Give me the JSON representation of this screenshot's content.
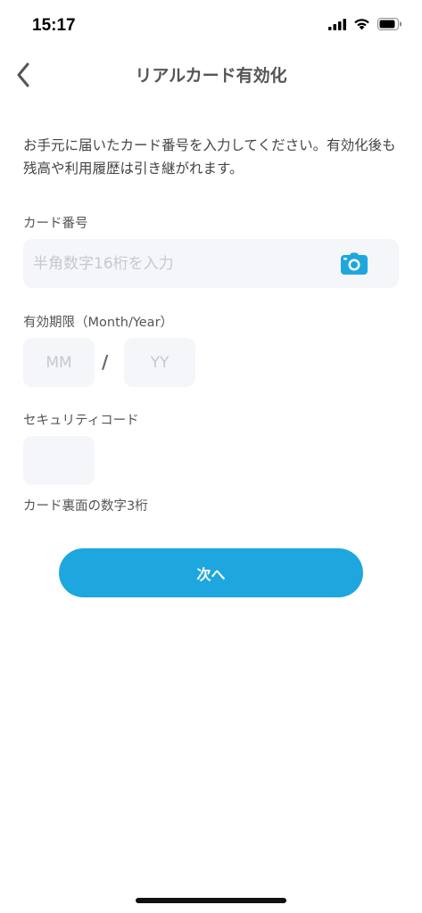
{
  "status_bar": {
    "time": "15:17"
  },
  "nav": {
    "title": "リアルカード有効化"
  },
  "description": "お手元に届いたカード番号を入力してください。有効化後も残高や利用履歴は引き継がれます。",
  "card_number": {
    "label": "カード番号",
    "placeholder": "半角数字16桁を入力"
  },
  "expiry": {
    "label": "有効期限（Month/Year）",
    "month_placeholder": "MM",
    "separator": "/",
    "year_placeholder": "YY"
  },
  "security_code": {
    "label": "セキュリティコード",
    "hint": "カード裏面の数字3桁"
  },
  "next_button": {
    "label": "次へ"
  },
  "colors": {
    "accent": "#1ea7df",
    "input_bg": "#f5f6f9"
  }
}
